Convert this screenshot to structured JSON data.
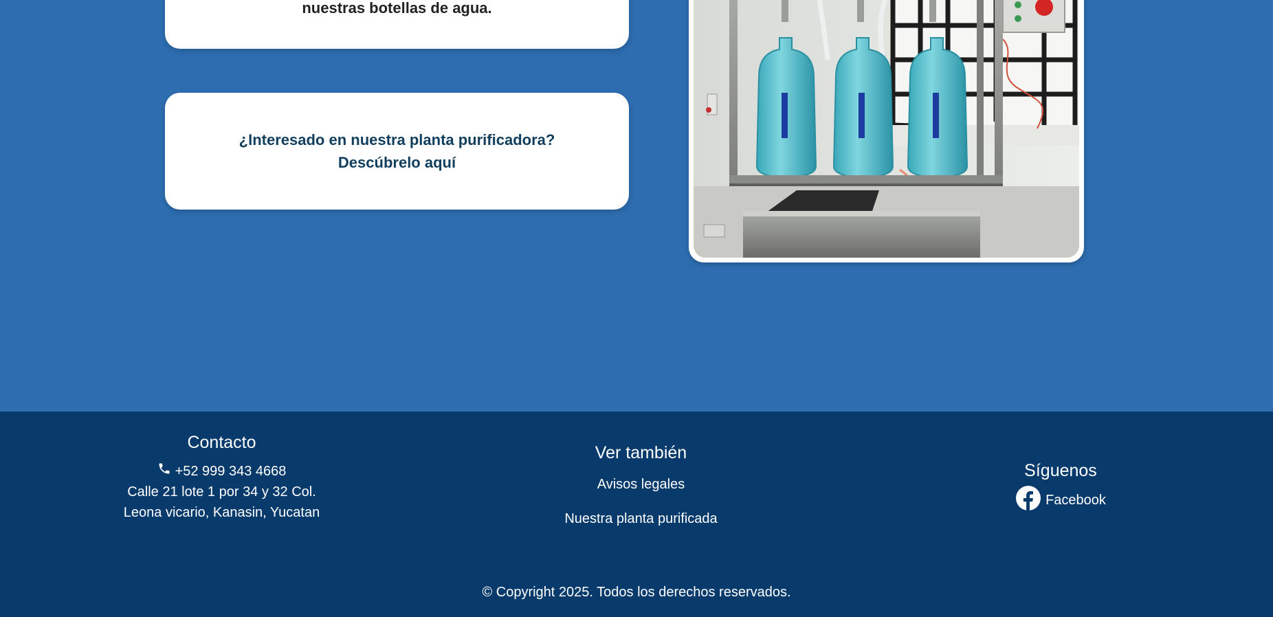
{
  "cards": {
    "card1_text": "nuestras botellas de agua.",
    "card2_line1": "¿Interesado en nuestra planta purificadora?",
    "card2_line2": "Descúbrelo aquí"
  },
  "colors": {
    "main_bg": "#2d6db0",
    "footer_bg": "#083a6c",
    "card_heading": "#123e5e"
  },
  "footer": {
    "contact": {
      "title": "Contacto",
      "phone_icon": "phone-icon",
      "phone": "+52 999 343 4668",
      "address_line1": "Calle 21 lote 1 por 34 y 32 Col.",
      "address_line2": "Leona vicario, Kanasin, Yucatan"
    },
    "see_also": {
      "title": "Ver también",
      "links": [
        "Avisos legales",
        "Nuestra planta purificada"
      ]
    },
    "follow": {
      "title": "Síguenos",
      "facebook_icon": "facebook-icon",
      "facebook_label": "Facebook"
    },
    "copyright": "© Copyright 2025. Todos los derechos reservados."
  }
}
